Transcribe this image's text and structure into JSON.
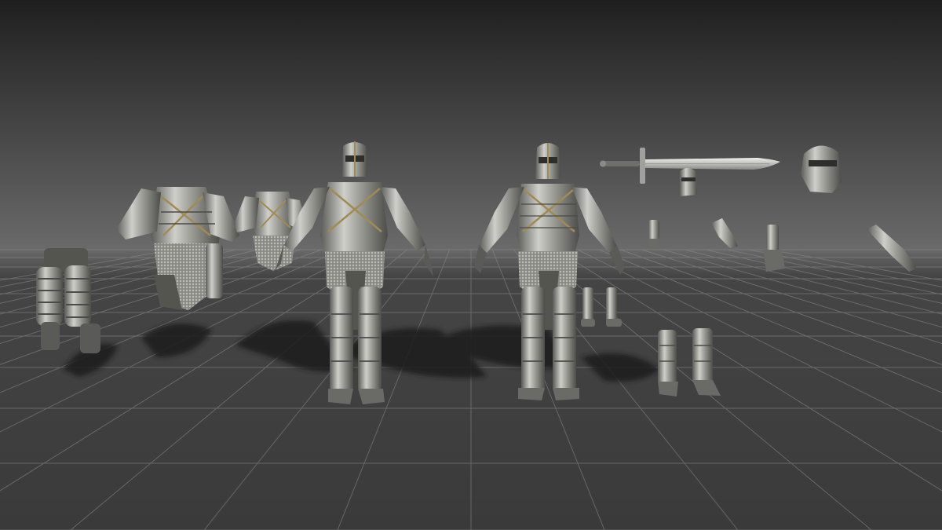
{
  "scene": {
    "kind": "3d-viewport",
    "description_visible_text": [],
    "colors": {
      "sky_top": "#1f1f1f",
      "sky_horizon": "#6a6a6a",
      "ground": "#3d3d3d",
      "grid_line": "#8a8a8a",
      "armor_light": "#c9c9c4",
      "armor_mid": "#8c8c86",
      "armor_dark": "#4a4a46",
      "trim_gold": "#a08a55",
      "chainmail": "#9a9a95",
      "cloth": "#555550",
      "shadow": "#1c1c1c",
      "blade": "#d8d8d4"
    },
    "objects": [
      {
        "name": "leg-armor-piece"
      },
      {
        "name": "torso-armor-large"
      },
      {
        "name": "torso-armor-small"
      },
      {
        "name": "knight-full-armor-1"
      },
      {
        "name": "knight-full-armor-2"
      },
      {
        "name": "sword"
      },
      {
        "name": "helmet-front"
      },
      {
        "name": "helmet-side"
      },
      {
        "name": "gauntlet-1"
      },
      {
        "name": "gauntlet-2"
      },
      {
        "name": "gauntlet-3"
      },
      {
        "name": "gauntlet-4"
      },
      {
        "name": "greaves-small"
      },
      {
        "name": "boots-large"
      }
    ]
  }
}
